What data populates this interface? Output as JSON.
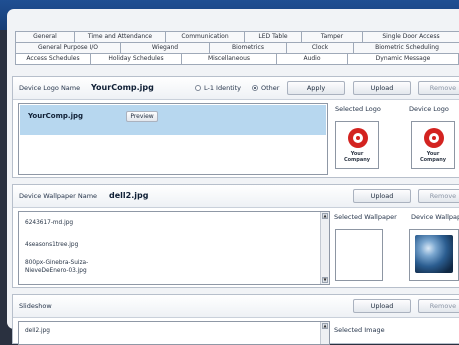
{
  "tabs": {
    "row1": [
      "General",
      "Time and Attendance",
      "Communication",
      "LED Table",
      "Tamper",
      "Single Door Access"
    ],
    "row2": [
      "General Purpose I/O",
      "Wiegand",
      "Biometrics",
      "Clock",
      "Biometric Scheduling"
    ],
    "row3": [
      "Access Schedules",
      "Holiday Schedules",
      "Miscellaneous",
      "Audio",
      "Dynamic Message"
    ]
  },
  "logo_section": {
    "name_label": "Device Logo Name",
    "name_value": "YourComp.jpg",
    "radio_l1": "L-1 Identity",
    "radio_other": "Other",
    "selected_radio": "Other",
    "apply_label": "Apply",
    "upload_label": "Upload",
    "remove_label": "Remove",
    "list_item": "YourComp.jpg",
    "preview_label": "Preview",
    "selected_logo_label": "Selected Logo",
    "device_logo_label": "Device Logo",
    "logo_caption_1": "Your",
    "logo_caption_2": "Company"
  },
  "wallpaper_section": {
    "name_label": "Device Wallpaper Name",
    "name_value": "dell2.jpg",
    "upload_label": "Upload",
    "remove_label": "Remove",
    "files": [
      "6243617-md.jpg",
      "4seasons1tree.jpg",
      "800px-Ginebra-Suiza-",
      "NieveDeEnero-03.jpg"
    ],
    "selected_wallpaper_label": "Selected Wallpaper",
    "device_wallpaper_label": "Device Wallpaper"
  },
  "slideshow_section": {
    "label": "Slideshow",
    "upload_label": "Upload",
    "remove_label": "Remove",
    "first_file": "dell2.jpg",
    "selected_image_label": "Selected Image"
  },
  "colors": {
    "header": "#1f4f93",
    "selection": "#b7d7ef",
    "logo_red": "#d32320"
  }
}
